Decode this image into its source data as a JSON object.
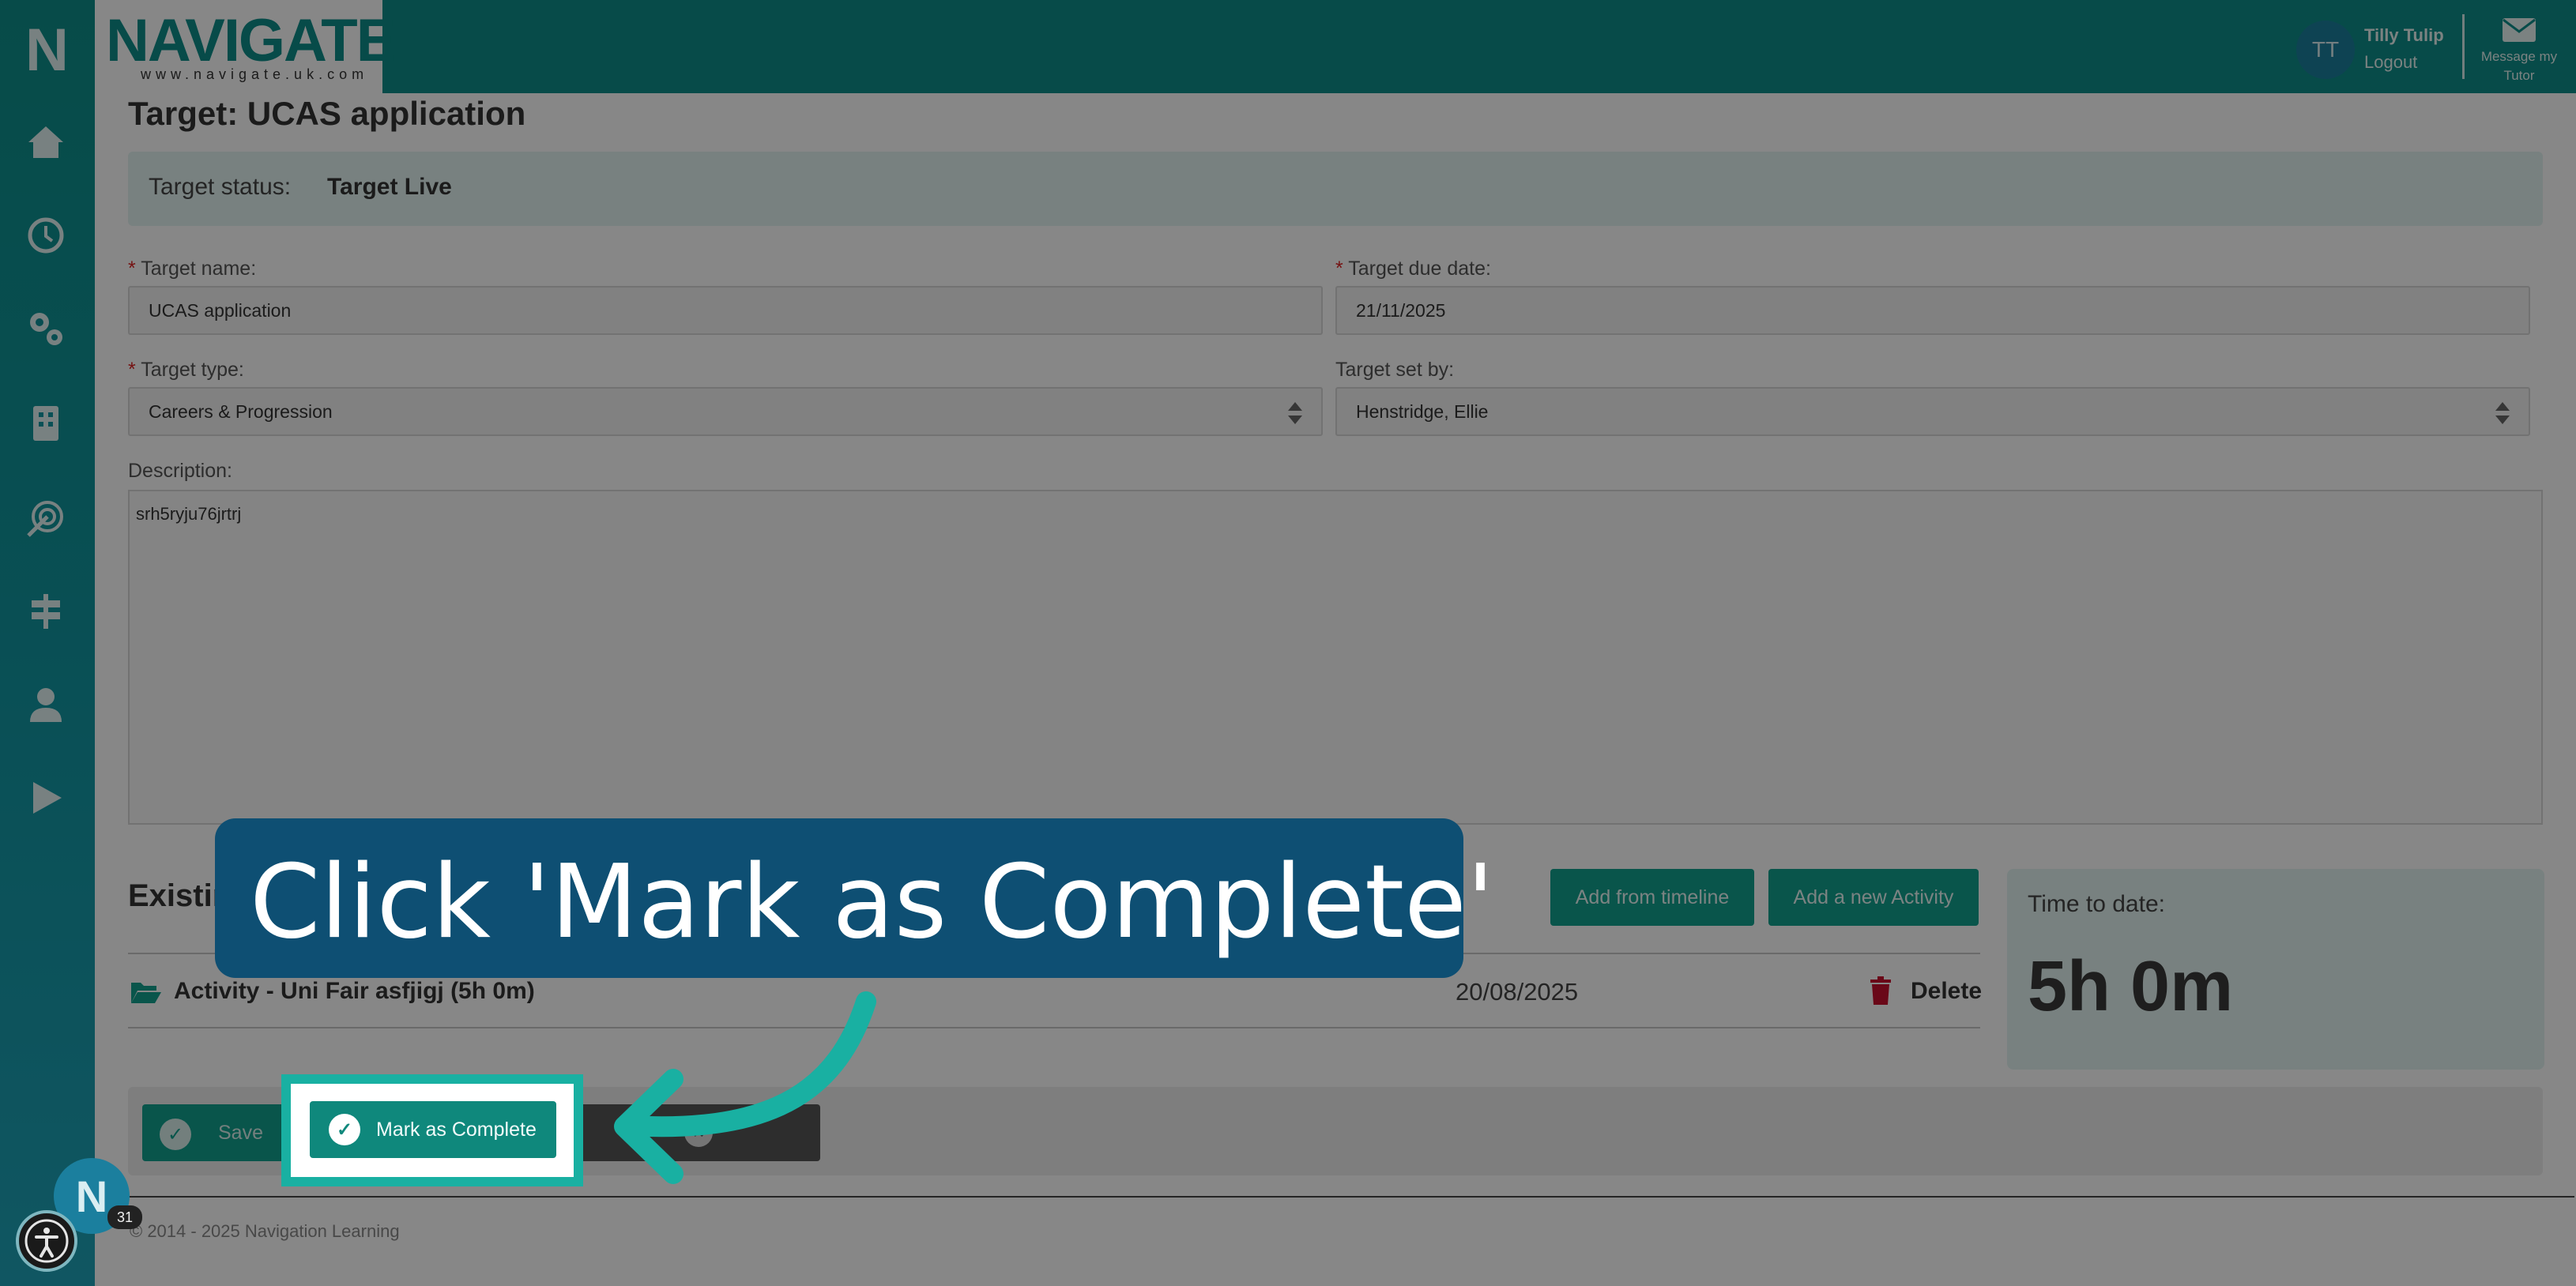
{
  "header": {
    "brand": "NAVIGATE",
    "brand_url": "www.navigate.uk.com",
    "sidebar_logo": "N",
    "user_initials": "TT",
    "user_name": "Tilly Tulip",
    "logout_label": "Logout",
    "message_label": "Message my Tutor"
  },
  "sidebar": {
    "items": [
      "home-icon",
      "clock-icon",
      "gears-icon",
      "building-icon",
      "target-icon",
      "signpost-icon",
      "user-icon",
      "play-icon"
    ]
  },
  "target": {
    "title": "Target: UCAS application",
    "status_label": "Target status:",
    "status_value": "Target Live",
    "name_label": "Target name:",
    "name_value": "UCAS application",
    "due_label": "Target due date:",
    "due_value": "21/11/2025",
    "type_label": "Target type:",
    "type_value": "Careers & Progression",
    "set_by_label": "Target set by:",
    "set_by_value": "Henstridge, Ellie",
    "description_label": "Description:",
    "description_value": "srh5ryju76jrtrj"
  },
  "activities": {
    "section_label": "Existin",
    "add_from_timeline": "Add from timeline",
    "add_new_activity": "Add a new Activity",
    "rows": [
      {
        "name": "Activity - Uni Fair asfjigj (5h 0m)",
        "date": "20/08/2025",
        "delete_label": "Delete"
      }
    ],
    "time_to_date_label": "Time to date:",
    "time_to_date_value": "5h 0m"
  },
  "actions": {
    "save_label": "Save",
    "mark_complete_label": "Mark as Complete"
  },
  "footer": {
    "copyright": "© 2014 - 2025 Navigation Learning"
  },
  "tutorial": {
    "callout_text": "Click 'Mark as Complete'"
  },
  "widgets": {
    "badge_letter": "N",
    "badge_count": "31"
  },
  "colors": {
    "brand_teal": "#0e8f8a",
    "button_teal": "#11a08f",
    "callout_navy": "#0e4f73",
    "highlight": "#19b0a2",
    "delete_red": "#c8102e"
  }
}
